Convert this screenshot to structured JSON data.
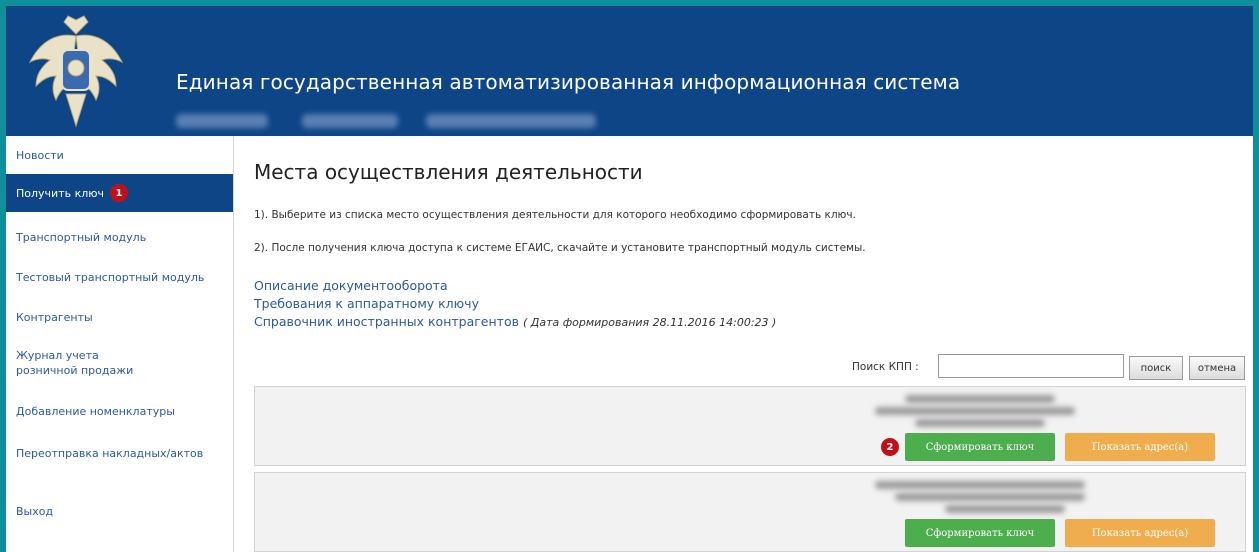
{
  "header": {
    "title": "Единая государственная автоматизированная информационная система"
  },
  "sidebar": {
    "items": [
      {
        "label": "Новости"
      },
      {
        "label": "Получить ключ",
        "badge": "1"
      },
      {
        "label": "Транспортный модуль"
      },
      {
        "label": "Тестовый транспортный модуль"
      },
      {
        "label": "Контрагенты"
      },
      {
        "label": "Журнал учета розничной продажи"
      },
      {
        "label": "Добавление номенклатуры"
      },
      {
        "label": "Переотправка накладных/актов"
      },
      {
        "label": "Выход"
      }
    ]
  },
  "main": {
    "title": "Места осуществления деятельности",
    "instruction1": "1). Выберите из списка место осуществления деятельности для которого необходимо сформировать ключ.",
    "instruction2": "2). После получения ключа доступа к системе ЕГАИС, скачайте и установите транспортный модуль системы.",
    "links": {
      "doc_flow": "Описание документооборота",
      "hw_key": "Требования к аппаратному ключу",
      "foreign": "Справочник иностранных контрагентов",
      "foreign_date": "( Дата формирования 28.11.2016 14:00:23 )"
    },
    "search": {
      "label": "Поиск КПП :",
      "value": "",
      "search_button": "поиск",
      "cancel_button": "отмена"
    },
    "cards": [
      {
        "generate_label": "Сформировать ключ",
        "address_label": "Показать адрес(а)",
        "badge": "2"
      },
      {
        "generate_label": "Сформировать ключ",
        "address_label": "Показать адрес(а)"
      }
    ]
  },
  "colors": {
    "header_bg": "#0d4586",
    "frame": "#0f8f9b",
    "link": "#2a5aa1",
    "green_button": "#4cae4c",
    "orange_button": "#f0ad4e",
    "badge": "#c0111a"
  }
}
